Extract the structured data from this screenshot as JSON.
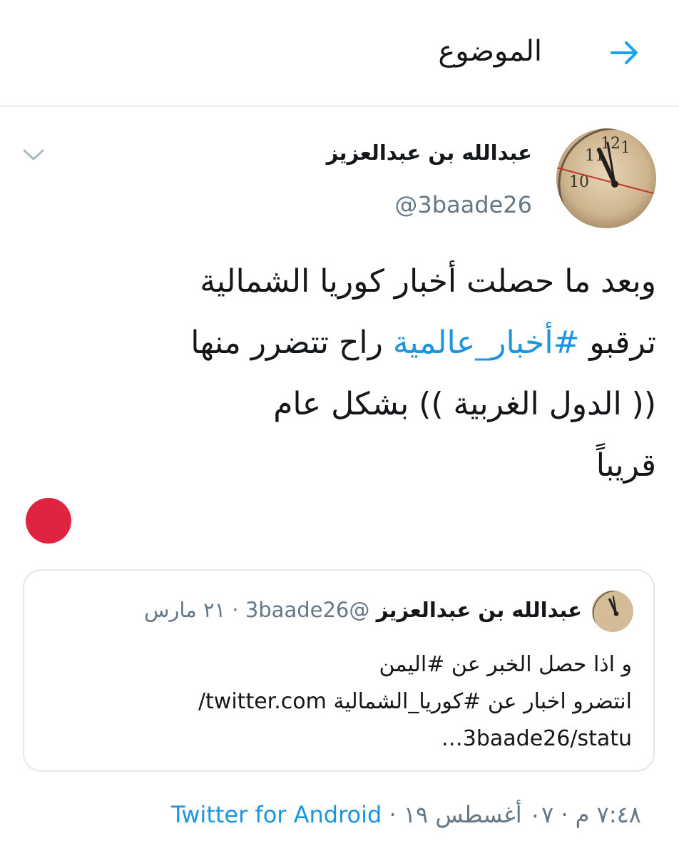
{
  "header": {
    "title": "الموضوع",
    "back_icon": "arrow-right-icon",
    "accent": "#1da1f2"
  },
  "tweet": {
    "author_name": "عبدالله بن عبدالعزيز",
    "author_handle": "@3baade26",
    "menu_icon": "chevron-down-icon",
    "text": {
      "line1": "وبعد ما حصلت أخبار كوريا الشمالية",
      "line2_before": "ترقبو ",
      "hashtag": "#أخبار_عالمية",
      "line2_after": " راح تتضرر منها",
      "line3": "(( الدول الغربية )) بشكل عام",
      "line4": "قريباً"
    },
    "emoji_color": "#e0243f",
    "timestamp": "٧:٤٨ م · ٠٧ أغسطس ١٩",
    "separator": " · ",
    "source": "Twitter for Android"
  },
  "quoted": {
    "author_name": "عبدالله بن عبدالعزيز",
    "author_handle": "@3baade26",
    "meta": " · ٢١ مارس",
    "line1": "و اذا حصل الخبر عن #اليمن",
    "line2": "انتضرو اخبار عن #كوريا_الشمالية twitter.com/",
    "line3": "3baade26/statu…"
  },
  "colors": {
    "link": "#1b95e0",
    "secondary_text": "#657786",
    "border": "#e1e8ed"
  }
}
